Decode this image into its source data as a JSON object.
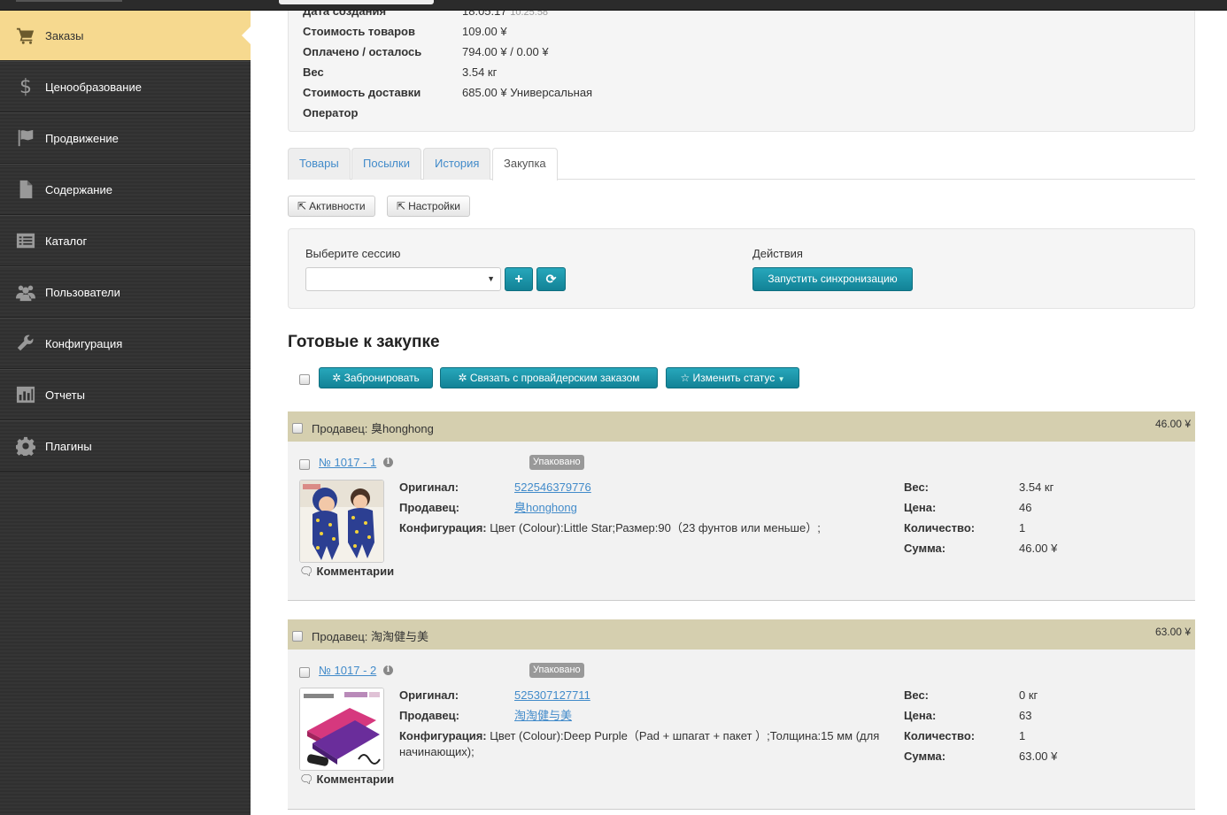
{
  "sidebar": {
    "items": [
      {
        "label": "Заказы",
        "icon": "cart-icon",
        "active": true
      },
      {
        "label": "Ценообразование",
        "icon": "dollar-icon"
      },
      {
        "label": "Продвижение",
        "icon": "flag-icon"
      },
      {
        "label": "Содержание",
        "icon": "file-icon"
      },
      {
        "label": "Каталог",
        "icon": "list-icon"
      },
      {
        "label": "Пользователи",
        "icon": "users-icon"
      },
      {
        "label": "Конфигурация",
        "icon": "wrench-icon"
      },
      {
        "label": "Отчеты",
        "icon": "bar-chart-icon"
      },
      {
        "label": "Плагины",
        "icon": "gear-icon"
      }
    ]
  },
  "order_info": {
    "created_label": "Дата создания",
    "created_value": "18:05:17",
    "created_sub": "10.25.58",
    "goods_cost_label": "Стоимость товаров",
    "goods_cost_value": "109.00 ¥",
    "paid_label": "Оплачено / осталось",
    "paid_value": "794.00 ¥ / 0.00 ¥",
    "weight_label": "Вес",
    "weight_value": "3.54 кг",
    "delivery_label": "Стоимость доставки",
    "delivery_value": "685.00 ¥ Универсальная",
    "operator_label": "Оператор",
    "operator_value": ""
  },
  "tabs": [
    {
      "label": "Товары"
    },
    {
      "label": "Посылки"
    },
    {
      "label": "История"
    },
    {
      "label": "Закупка",
      "active": true
    }
  ],
  "toolbar": {
    "activities_label": "Активности",
    "settings_label": "Настройки"
  },
  "session": {
    "select_label": "Выберите сессию",
    "selected_value": "",
    "actions_label": "Действия",
    "sync_label": "Запустить синхронизацию"
  },
  "ready": {
    "heading": "Готовые к закупке",
    "reserve_label": "Забронировать",
    "link_label": "Связать с провайдерским заказом",
    "status_label": "Изменить статус"
  },
  "groups": [
    {
      "seller_prefix": "Продавец:",
      "seller": "臭honghong",
      "total": "46.00 ¥",
      "item": {
        "number": "№ 1017 - 1",
        "status": "Упаковано",
        "original_label": "Оригинал:",
        "original": "522546379776",
        "seller_label": "Продавец:",
        "seller": "臭honghong",
        "config_label": "Конфигурация:",
        "config": "Цвет (Colour):Little Star;Размер:90（23 фунтов или меньше）;",
        "weight_label": "Вес:",
        "weight": "3.54 кг",
        "price_label": "Цена:",
        "price": "46",
        "qty_label": "Количество:",
        "qty": "1",
        "sum_label": "Сумма:",
        "sum": "46.00 ¥",
        "comments": "Комментарии"
      }
    },
    {
      "seller_prefix": "Продавец:",
      "seller": "淘淘健与美",
      "total": "63.00 ¥",
      "item": {
        "number": "№ 1017 - 2",
        "status": "Упаковано",
        "original_label": "Оригинал:",
        "original": "525307127711",
        "seller_label": "Продавец:",
        "seller": "淘淘健与美",
        "config_label": "Конфигурация:",
        "config": "Цвет (Colour):Deep Purple（Pad + шпагат + пакет ）;Толщина:15 мм (для начинающих);",
        "weight_label": "Вес:",
        "weight": "0 кг",
        "price_label": "Цена:",
        "price": "63",
        "qty_label": "Количество:",
        "qty": "1",
        "sum_label": "Сумма:",
        "sum": "63.00 ¥",
        "comments": "Комментарии"
      }
    }
  ]
}
